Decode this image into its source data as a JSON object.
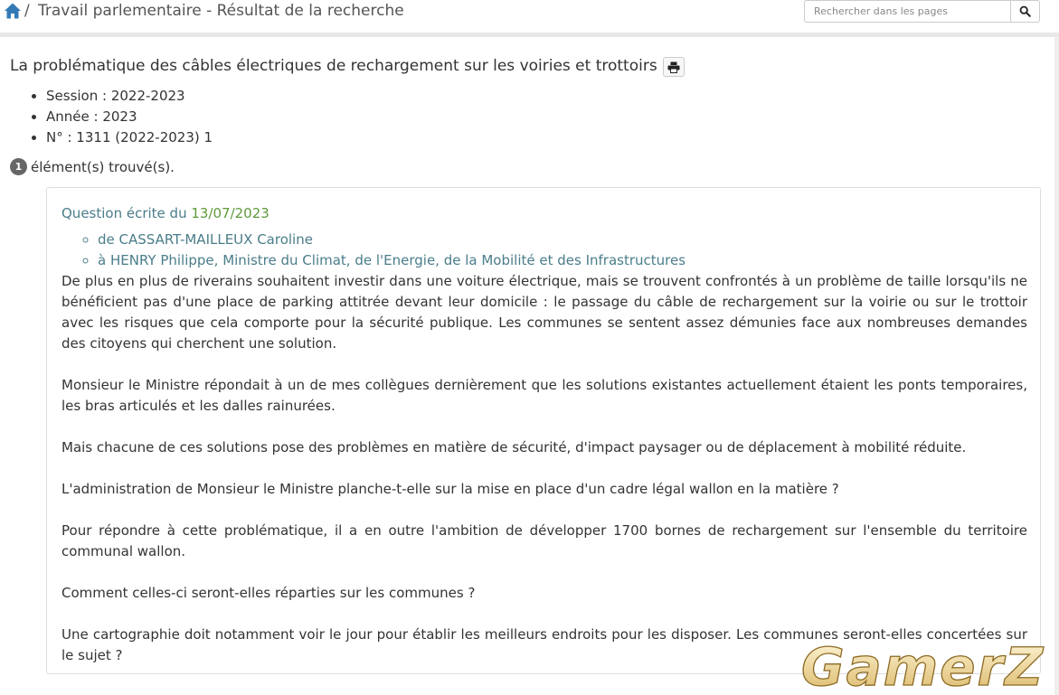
{
  "header": {
    "breadcrumb_sep": "/",
    "breadcrumb_title": "Travail parlementaire - Résultat de la recherche",
    "search_placeholder": "Rechercher dans les pages",
    "icons": {
      "home": "home-icon",
      "search": "search-icon"
    }
  },
  "page": {
    "title": "La problématique des câbles électriques de rechargement sur les voiries et trottoirs",
    "print_icon": "print-icon",
    "meta": [
      "Session : 2022-2023",
      "Année : 2023",
      "N° : 1311 (2022-2023) 1"
    ],
    "result_count": "1",
    "result_count_label": "élément(s) trouvé(s)."
  },
  "question": {
    "header_label": "Question écrite du",
    "date": "13/07/2023",
    "from": "de CASSART-MAILLEUX Caroline",
    "to": "à HENRY Philippe, Ministre du Climat, de l'Energie, de la Mobilité et des Infrastructures",
    "paragraphs": [
      "De plus en plus de riverains souhaitent investir dans une voiture électrique, mais se trouvent confrontés à un problème de taille lorsqu'ils ne bénéficient pas d'une place de parking attitrée devant leur domicile : le passage du câble de rechargement sur la voirie ou sur le trottoir avec les risques que cela comporte pour la sécurité publique. Les communes se sentent assez démunies face aux nombreuses demandes des citoyens qui cherchent une solution.",
      "Monsieur le Ministre répondait à un de mes collègues dernièrement que les solutions existantes actuellement étaient les ponts temporaires, les bras articulés et les dalles rainurées.",
      "Mais chacune de ces solutions pose des problèmes en matière de sécurité, d'impact paysager ou de déplacement à mobilité réduite.",
      "L'administration de Monsieur le Ministre planche-t-elle sur la mise en place d'un cadre légal wallon en la matière ?",
      "Pour répondre à cette problématique, il a en outre l'ambition de développer 1700 bornes de rechargement sur l'ensemble du territoire communal wallon.",
      "Comment celles-ci seront-elles réparties sur les communes ?",
      "Une cartographie doit notamment voir le jour pour établir les meilleurs endroits pour les disposer. Les communes seront-elles concertées sur le sujet ?"
    ]
  },
  "watermark": {
    "text": "GamerZ"
  },
  "colors": {
    "link_teal": "#4a7d8a",
    "date_green": "#5e9a3a",
    "home_blue": "#337ab7",
    "badge_grey": "#666666"
  }
}
